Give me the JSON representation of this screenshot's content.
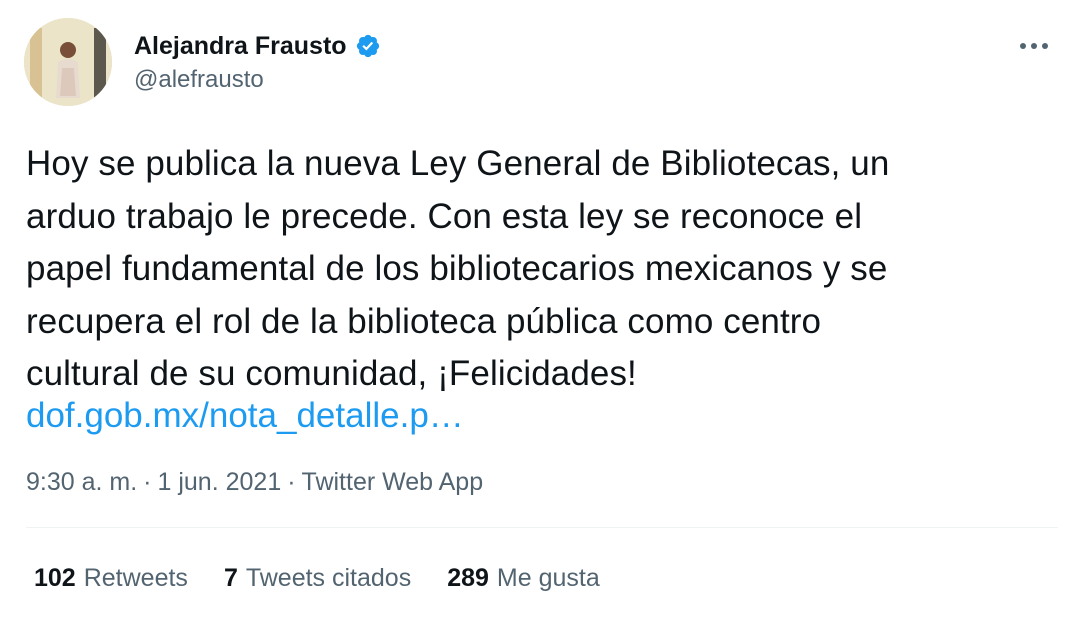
{
  "author": {
    "display_name": "Alejandra Frausto",
    "handle": "@alefrausto",
    "verified_icon": "verified-badge-icon",
    "verified_color": "#1d9bf0"
  },
  "tweet": {
    "text": "Hoy se publica la nueva Ley General de Bibliotecas, un\narduo trabajo le precede. Con esta ley se reconoce el\npapel fundamental de los bibliotecarios mexicanos y se\nrecupera el rol de la biblioteca pública como centro\ncultural de su comunidad, ¡Felicidades!",
    "link_text": "dof.gob.mx/nota_detalle.p…",
    "time": "9:30 a. m.",
    "date": "1 jun. 2021",
    "source": "Twitter Web App",
    "separator": "·"
  },
  "stats": {
    "retweets_count": "102",
    "retweets_label": "Retweets",
    "quotes_count": "7",
    "quotes_label": "Tweets citados",
    "likes_count": "289",
    "likes_label": "Me gusta"
  },
  "colors": {
    "link": "#1d9bf0",
    "secondary_text": "#536471",
    "primary_text": "#0f1419"
  }
}
